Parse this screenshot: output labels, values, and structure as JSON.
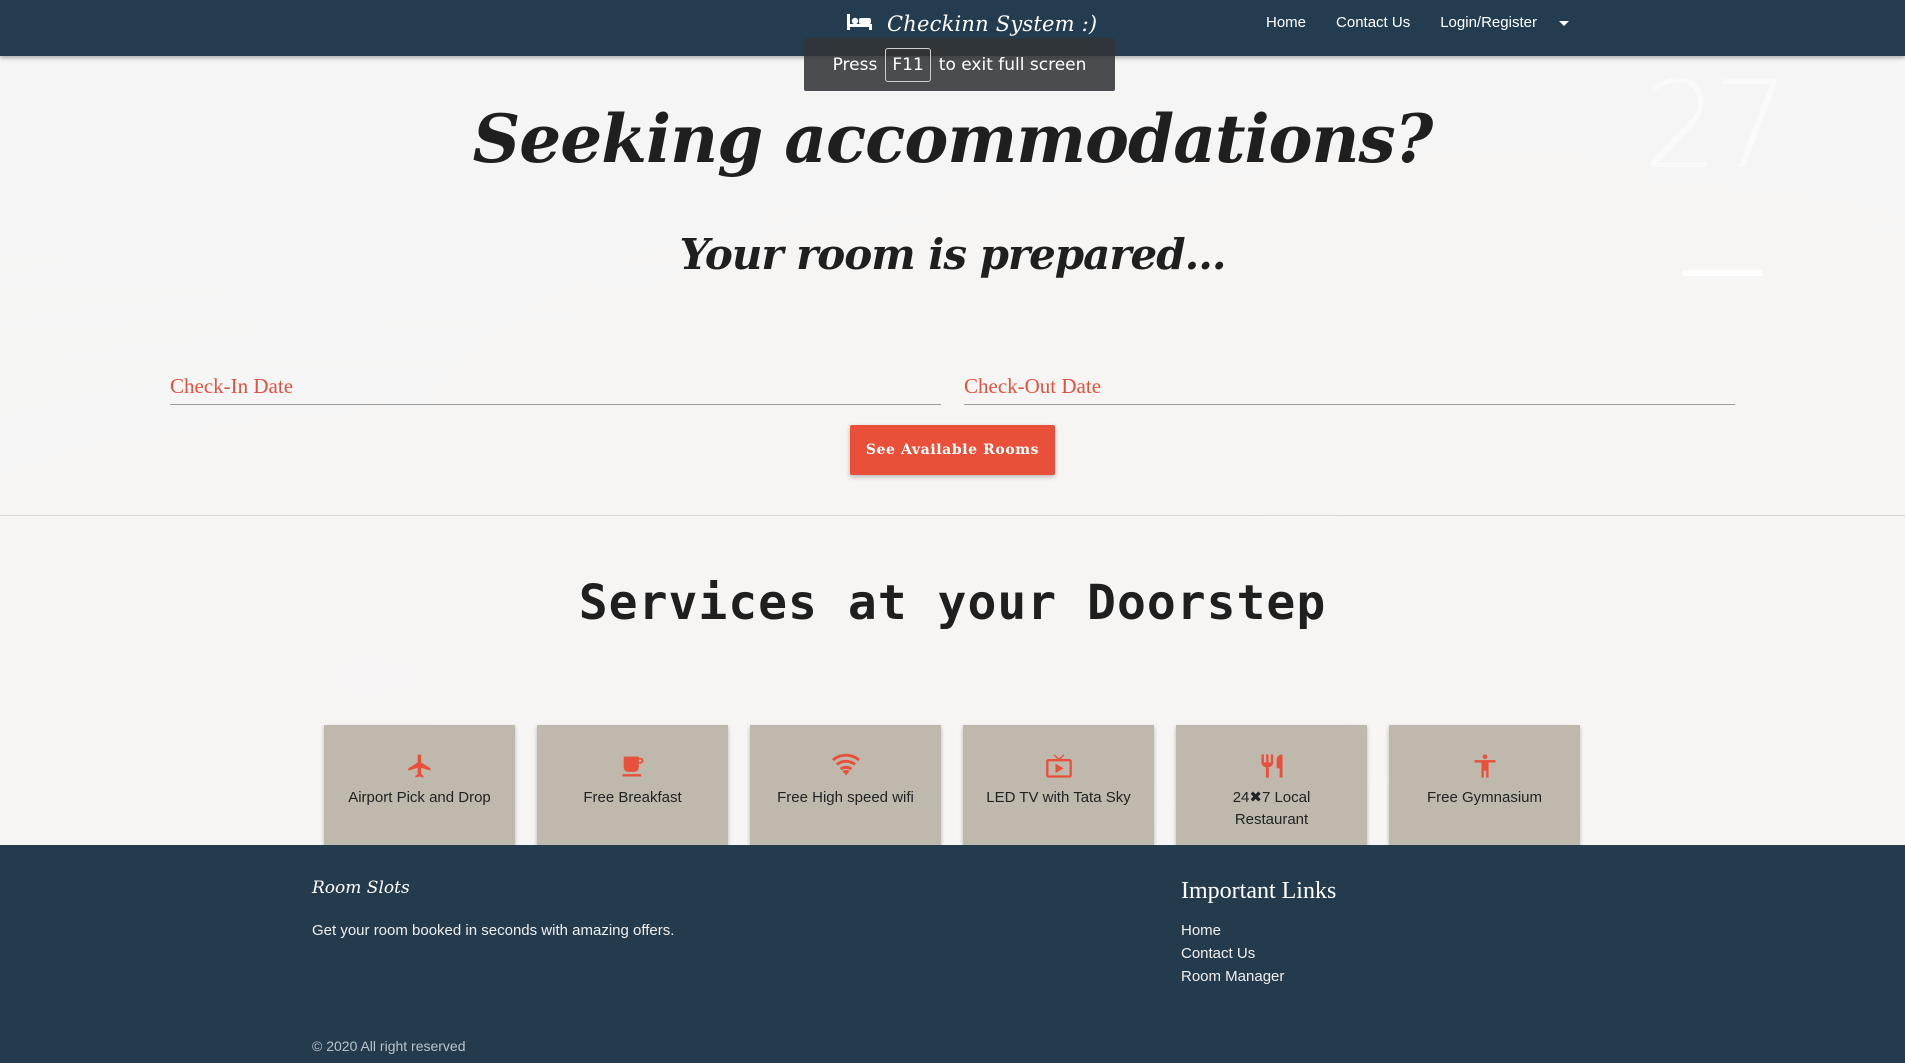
{
  "navbar": {
    "brand": "Checkinn System :)",
    "links": [
      "Home",
      "Contact Us",
      "Login/Register"
    ]
  },
  "overlay": {
    "press": "Press",
    "key": "F11",
    "suffix": "to exit full screen"
  },
  "hero": {
    "title": "Seeking accommodations?",
    "subtitle": "Your room is prepared..."
  },
  "search": {
    "checkin_placeholder": "Check-In Date",
    "checkout_placeholder": "Check-Out Date",
    "button": "See Available Rooms"
  },
  "services": {
    "title": "Services at your Doorstep",
    "items": [
      {
        "icon": "airplane-icon",
        "label": "Airport Pick and Drop"
      },
      {
        "icon": "coffee-cup-icon",
        "label": "Free Breakfast"
      },
      {
        "icon": "wifi-icon",
        "label": "Free High speed wifi"
      },
      {
        "icon": "tv-icon",
        "label": "LED TV with Tata Sky"
      },
      {
        "icon": "restaurant-icon",
        "label": "24✖7 Local Restaurant"
      },
      {
        "icon": "gym-icon",
        "label": "Free Gymnasium"
      }
    ]
  },
  "footer": {
    "brand": "Room Slots",
    "tagline": "Get your room booked in seconds with amazing offers.",
    "links_title": "Important Links",
    "links": [
      "Home",
      "Contact Us",
      "Room Manager"
    ],
    "copyright": "© 2020 All right reserved"
  },
  "colors": {
    "navbar": "#233c4f",
    "accent": "#e8503a",
    "card": "#bfb9ad",
    "footer": "#243b4d"
  }
}
